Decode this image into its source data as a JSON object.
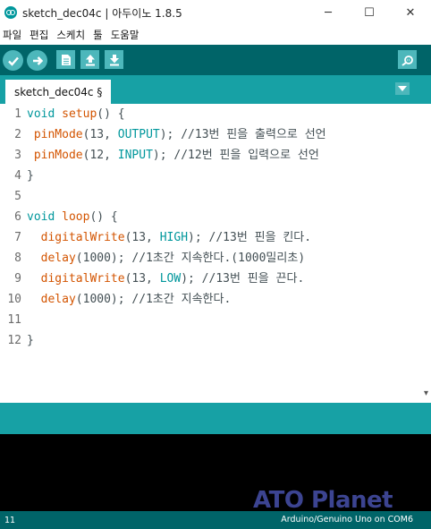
{
  "window": {
    "title": "sketch_dec04c | 아두이노 1.8.5",
    "controls": {
      "minimize": "─",
      "maximize": "☐",
      "close": "✕"
    }
  },
  "menu": [
    "파일",
    "편집",
    "스케치",
    "툴",
    "도움말"
  ],
  "toolbar": {
    "buttons": [
      "verify-icon",
      "upload-icon",
      "new-icon",
      "open-icon",
      "save-icon",
      "serial-monitor-icon"
    ]
  },
  "tabs": [
    {
      "label": "sketch_dec04c §"
    }
  ],
  "editor": {
    "line_numbers": [
      "1",
      "2",
      "3",
      "4",
      "5",
      "6",
      "7",
      "8",
      "9",
      "10",
      "11",
      "12"
    ],
    "lines": [
      [
        {
          "t": "void",
          "c": "kw-type"
        },
        {
          "t": " "
        },
        {
          "t": "setup",
          "c": "kw-func"
        },
        {
          "t": "() {"
        }
      ],
      [
        {
          "t": " "
        },
        {
          "t": "pinMode",
          "c": "kw-func"
        },
        {
          "t": "(13, "
        },
        {
          "t": "OUTPUT",
          "c": "kw-const"
        },
        {
          "t": "); //13번 핀을 출력으로 선언",
          "c": "cmt"
        }
      ],
      [
        {
          "t": " "
        },
        {
          "t": "pinMode",
          "c": "kw-func"
        },
        {
          "t": "(12, "
        },
        {
          "t": "INPUT",
          "c": "kw-const"
        },
        {
          "t": "); //12번 핀을 입력으로 선언",
          "c": "cmt"
        }
      ],
      [
        {
          "t": "}"
        }
      ],
      [
        {
          "t": ""
        }
      ],
      [
        {
          "t": "void",
          "c": "kw-type"
        },
        {
          "t": " "
        },
        {
          "t": "loop",
          "c": "kw-func"
        },
        {
          "t": "() {"
        }
      ],
      [
        {
          "t": "  "
        },
        {
          "t": "digitalWrite",
          "c": "kw-func"
        },
        {
          "t": "(13, "
        },
        {
          "t": "HIGH",
          "c": "kw-const"
        },
        {
          "t": "); //13번 핀을 킨다.",
          "c": "cmt"
        }
      ],
      [
        {
          "t": "  "
        },
        {
          "t": "delay",
          "c": "kw-func"
        },
        {
          "t": "(1000); //1초간 지속한다.(1000밀리초)",
          "c": "cmt"
        }
      ],
      [
        {
          "t": "  "
        },
        {
          "t": "digitalWrite",
          "c": "kw-func"
        },
        {
          "t": "(13, "
        },
        {
          "t": "LOW",
          "c": "kw-const"
        },
        {
          "t": "); //13번 핀을 끈다.",
          "c": "cmt"
        }
      ],
      [
        {
          "t": "  "
        },
        {
          "t": "delay",
          "c": "kw-func"
        },
        {
          "t": "(1000); //1초간 지속한다.",
          "c": "cmt"
        }
      ],
      [
        {
          "t": ""
        }
      ],
      [
        {
          "t": "}"
        }
      ]
    ]
  },
  "status": {
    "line": "11",
    "board": "Arduino/Genuino Uno on COM6"
  },
  "watermark": "ATO Planet",
  "colors": {
    "toolbar": "#006468",
    "tabstrip": "#17a1a5",
    "button": "#4db7bb",
    "keyword": "#00979c",
    "function": "#d35400"
  }
}
